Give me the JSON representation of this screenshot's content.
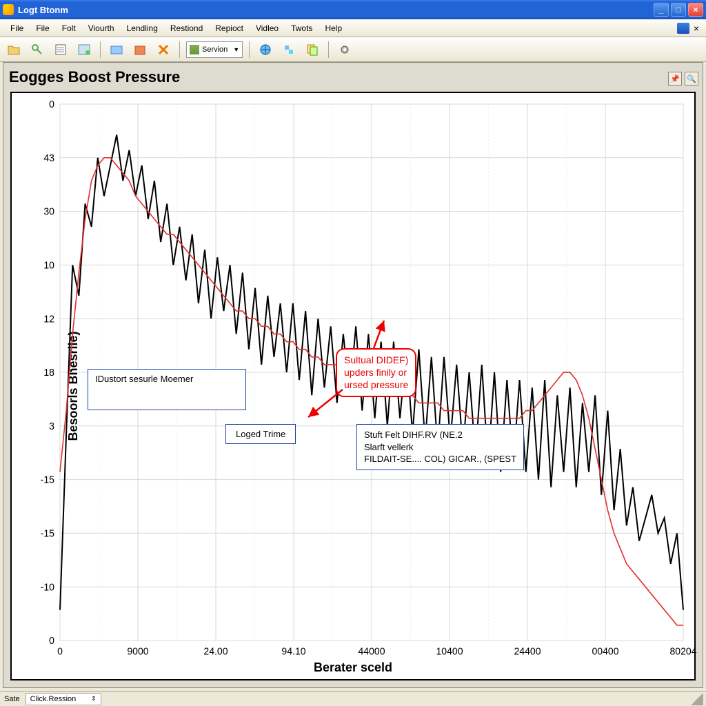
{
  "window": {
    "title": "Logt Btonm"
  },
  "menu": {
    "items": [
      "File",
      "File",
      "Folt",
      "Viourth",
      "Lendling",
      "Restiond",
      "Repioct",
      "Vidleo",
      "Twots",
      "Help"
    ]
  },
  "toolbar": {
    "combo_label": "Servion",
    "icons": [
      "open",
      "key",
      "form",
      "sheet",
      "folder",
      "box",
      "xmark",
      "combo",
      "globe",
      "puzzle",
      "copy",
      "gear"
    ]
  },
  "chart": {
    "title": "Eogges Boost Pressure",
    "tool_icons": [
      "pin",
      "search"
    ]
  },
  "annotations": {
    "box1": "IDustort sesurle Moemer",
    "box2": "Loged Trime",
    "callout": "Sultual DIDEF)\nupders finily or\nursed pressure",
    "box3": "Stuft Felt DIHF.RV (NE.2\nSlarft vellerk\nFILDAIT-SE.... COL) GICAR., (SPEST"
  },
  "status": {
    "left": "Sate",
    "field": "Click.Ression"
  },
  "chart_data": {
    "type": "line",
    "title": "Eogges Boost Pressure",
    "xlabel": "Berater sceld",
    "ylabel": "Besoorls Bhesriie)",
    "x_ticks": [
      "0",
      "9000",
      "24.00",
      "94.10",
      "44000",
      "10400",
      "24400",
      "00400",
      "80204"
    ],
    "y_ticks_top_to_bottom": [
      "0",
      "43",
      "30",
      "10",
      "12",
      "18",
      "3",
      "-15",
      "-15",
      "-10",
      "0"
    ],
    "series": [
      {
        "name": "raw",
        "color": "#000",
        "stroke": 2,
        "values": [
          -18,
          5,
          27,
          23,
          35,
          32,
          41,
          36,
          40,
          44,
          38,
          42,
          36,
          40,
          33,
          38,
          30,
          35,
          27,
          32,
          25,
          31,
          22,
          29,
          20,
          28,
          21,
          27,
          18,
          26,
          16,
          24,
          14,
          23,
          15,
          22,
          13,
          22,
          12,
          21,
          10,
          20,
          11,
          19,
          9,
          18,
          10,
          19,
          8,
          18,
          7,
          17,
          6,
          17,
          7,
          16,
          5,
          16,
          4,
          15,
          3,
          15,
          4,
          14,
          3,
          13,
          2,
          14,
          1,
          13,
          0,
          12,
          1,
          12,
          0,
          11,
          -1,
          12,
          -2,
          10,
          0,
          11,
          -2,
          9,
          0,
          10,
          -3,
          8,
          -5,
          3,
          -7,
          -2,
          -9,
          -6,
          -3,
          -8,
          -6,
          -12,
          -8,
          -18
        ]
      },
      {
        "name": "smoothed",
        "color": "#e03030",
        "stroke": 1.6,
        "values": [
          0,
          8,
          18,
          26,
          33,
          38,
          40,
          41,
          41,
          40,
          39,
          38,
          36,
          35,
          34,
          33,
          32,
          31,
          31,
          30,
          29,
          28,
          27,
          26,
          25,
          24,
          23,
          22,
          21,
          21,
          20,
          20,
          19,
          19,
          18,
          18,
          17,
          17,
          16,
          16,
          15,
          15,
          14,
          14,
          14,
          13,
          13,
          13,
          12,
          12,
          12,
          11,
          11,
          11,
          10,
          10,
          10,
          9,
          9,
          9,
          9,
          8,
          8,
          8,
          8,
          7,
          7,
          7,
          7,
          7,
          7,
          7,
          7,
          7,
          8,
          8,
          9,
          10,
          11,
          12,
          13,
          13,
          12,
          10,
          7,
          3,
          -1,
          -5,
          -8,
          -10,
          -12,
          -13,
          -14,
          -15,
          -16,
          -17,
          -18,
          -19,
          -20,
          -20
        ]
      }
    ],
    "ylim": [
      -22,
      48
    ],
    "xlim": [
      0,
      100
    ]
  }
}
